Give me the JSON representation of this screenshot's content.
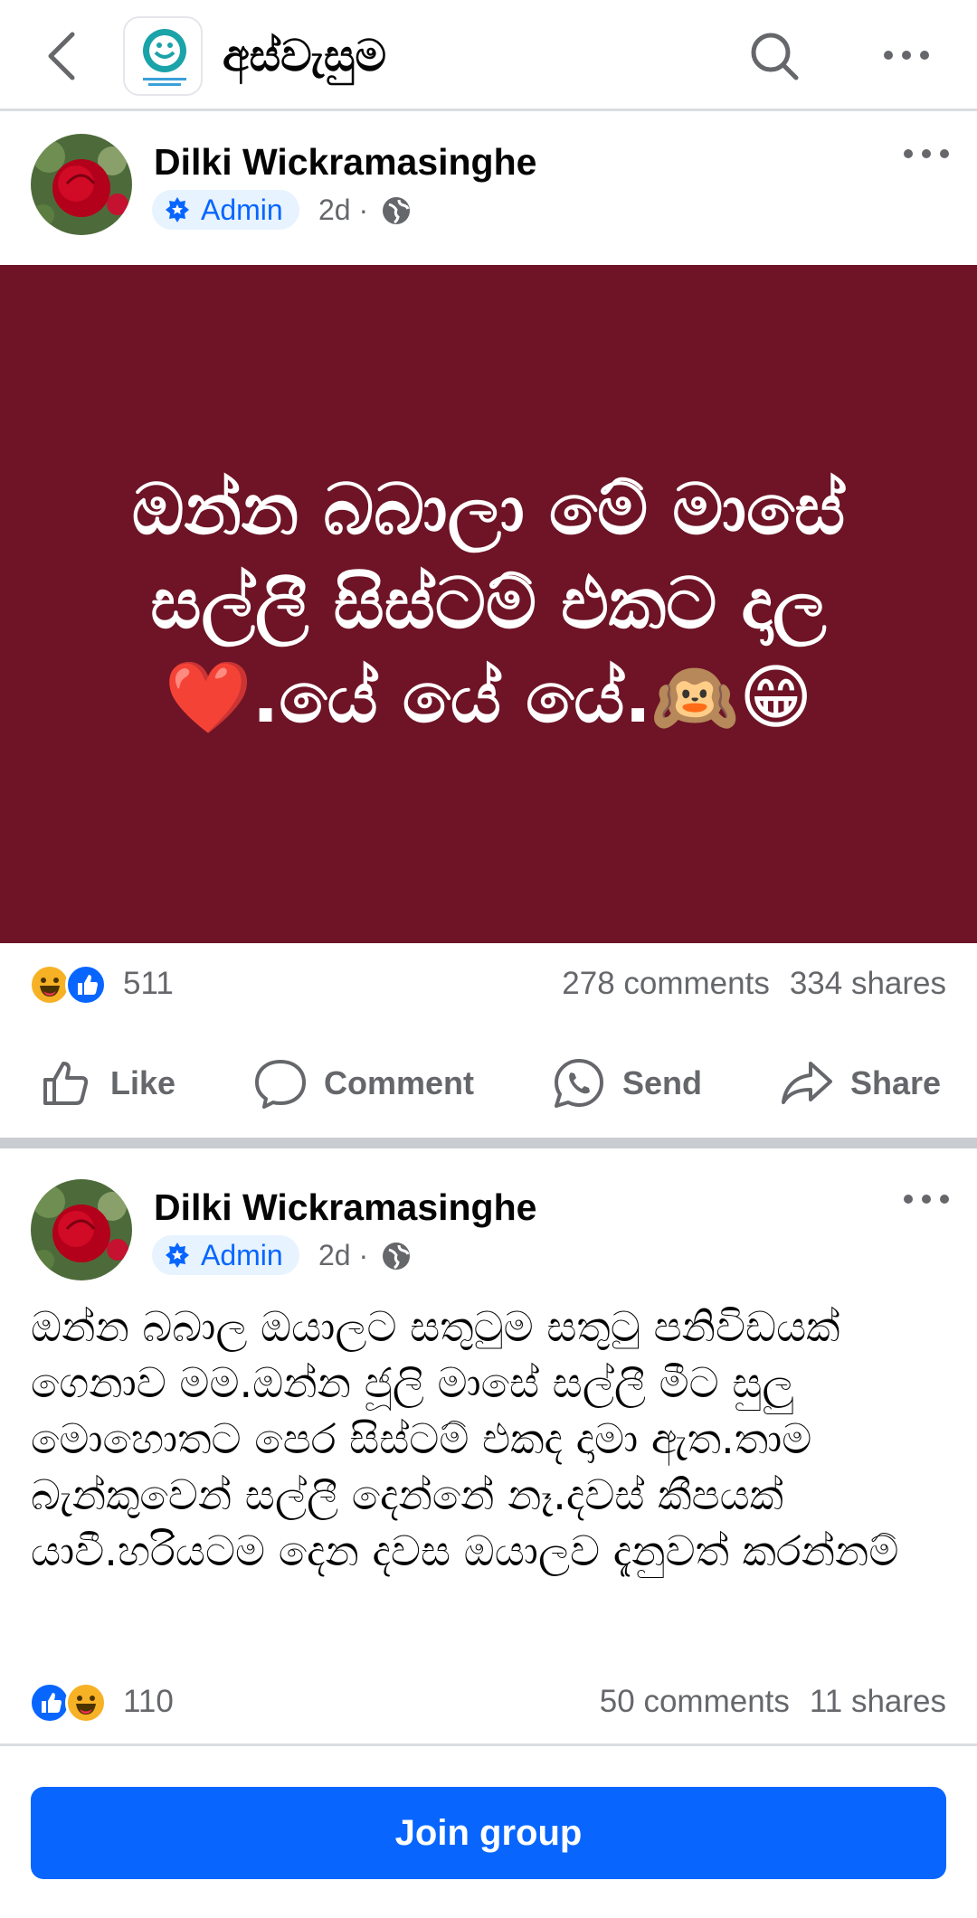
{
  "appbar": {
    "group_name": "අස්වැසුම",
    "back_icon": "chevron-left-icon",
    "search_icon": "search-icon",
    "more_icon": "more-horizontal-icon"
  },
  "posts": [
    {
      "author": "Dilki Wickramasinghe",
      "badge": "Admin",
      "time": "2d ·",
      "background_color": "#6e1426",
      "text": "ඔන්න බබාලා මේ මාසේ සල්ලී  සිස්ටම් එකට දාල ❤️.යේ යේ යේ.🙉😁",
      "reactions": {
        "icons": [
          "haha",
          "like"
        ],
        "count": "511"
      },
      "comments": "278 comments",
      "shares": "334 shares"
    },
    {
      "author": "Dilki Wickramasinghe",
      "badge": "Admin",
      "time": "2d ·",
      "text": "ඔන්න බබාල ඔයාලට සතුටුම සතුටු පනිවිඩයක් ගෙනාව මම.ඔන්න ජූලි මාසේ සල්ලී මීට සුලු මොහොතට පෙර සිස්ටම් එකද දාමා ඇත.තාම බැන්කුවෙන් සල්ලී දෙන්නේ නෑ.දවස් කීපයක් යාවී.හරියටම දෙන දවස ඔයාලව දැනුවත් කරන්නම්",
      "reactions": {
        "icons": [
          "like",
          "haha"
        ],
        "count": "110"
      },
      "comments": "50 comments",
      "shares": "11 shares"
    }
  ],
  "actions": {
    "like": "Like",
    "comment": "Comment",
    "send": "Send",
    "share": "Share"
  },
  "join_button": "Join group",
  "colors": {
    "accent": "#0866ff",
    "muted": "#65676b",
    "badge_bg": "#e7f3ff"
  }
}
